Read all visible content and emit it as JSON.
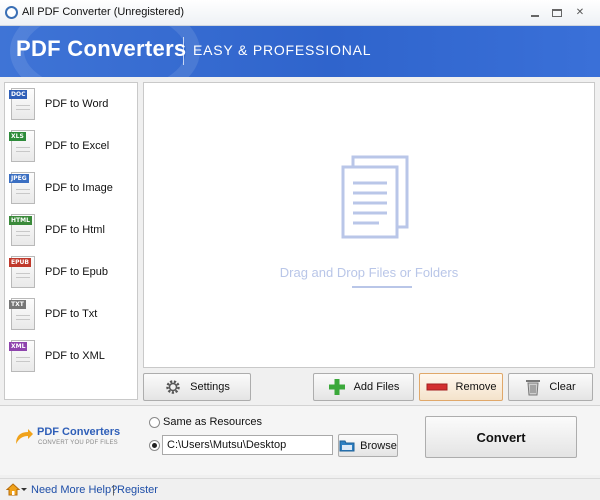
{
  "window": {
    "title": "All PDF Converter (Unregistered)",
    "controls": [
      "minimize-icon",
      "maximize-icon",
      "close-icon"
    ]
  },
  "banner": {
    "title": "PDF Converters",
    "tagline": "EASY & PROFESSIONAL"
  },
  "sidebar": {
    "items": [
      {
        "label": "PDF to Word",
        "tag": "DOC",
        "color": "#2f5fb8"
      },
      {
        "label": "PDF to Excel",
        "tag": "XLS",
        "color": "#2e8b3a"
      },
      {
        "label": "PDF to Image",
        "tag": "JPEG",
        "color": "#3b6fc2"
      },
      {
        "label": "PDF to Html",
        "tag": "HTML",
        "color": "#3a8a3a"
      },
      {
        "label": "PDF to Epub",
        "tag": "EPUB",
        "color": "#c0392b"
      },
      {
        "label": "PDF to Txt",
        "tag": "TXT",
        "color": "#777777"
      },
      {
        "label": "PDF to XML",
        "tag": "XML",
        "color": "#8e44ad"
      }
    ]
  },
  "dropzone": {
    "text": "Drag and Drop Files or Folders"
  },
  "actions": {
    "settings": "Settings",
    "add_files": "Add Files",
    "remove": "Remove",
    "clear": "Clear"
  },
  "output": {
    "logo_name": "PDF Converters",
    "logo_sub": "CONVERT YOU PDF FILES",
    "same_as_resources": "Same as Resources",
    "path": "C:\\Users\\Mutsu\\Desktop",
    "browse": "Browse",
    "convert": "Convert",
    "selected_option": "custom"
  },
  "status": {
    "help": "Need More Help?",
    "separator": "|",
    "register": "Register"
  },
  "colors": {
    "banner": "#3a6fd2",
    "drop_accent": "#b9c6e8",
    "add_plus": "#3aa83a",
    "remove_bar": "#d32f2f",
    "link": "#1f4fa8"
  }
}
